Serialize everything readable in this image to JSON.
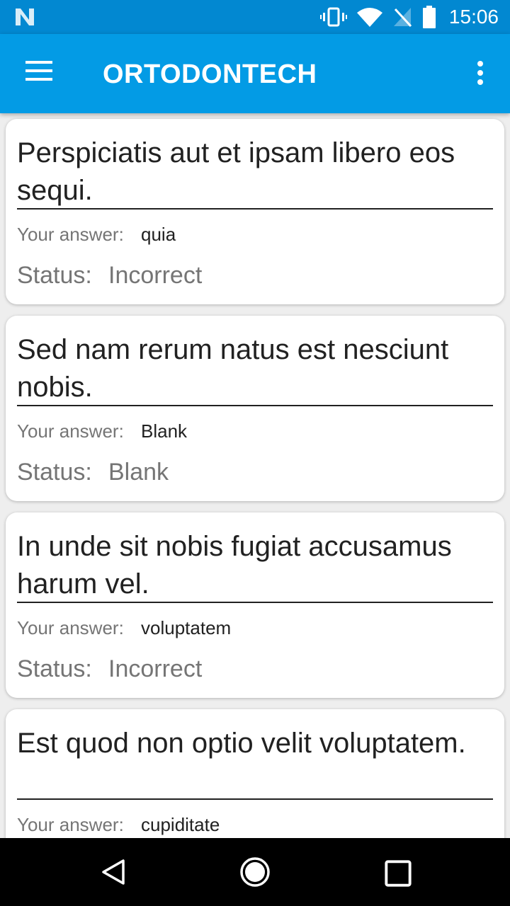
{
  "status_bar": {
    "time": "15:06",
    "icons": [
      "n-logo-icon",
      "vibrate-icon",
      "wifi-icon",
      "no-sim-icon",
      "battery-icon"
    ]
  },
  "app_bar": {
    "title": "ORTODONTECH",
    "icons": [
      "menu-icon",
      "more-vert-icon"
    ]
  },
  "colors": {
    "status_bar": "#0288d1",
    "app_bar": "#039be5",
    "background": "#eeeeee",
    "card": "#ffffff"
  },
  "labels": {
    "your_answer": "Your answer:",
    "status": "Status:"
  },
  "questions": [
    {
      "text": "Perspiciatis aut et ipsam libero eos sequi.",
      "answer": "quia",
      "status": "Incorrect"
    },
    {
      "text": "Sed nam rerum natus est nesciunt nobis.",
      "answer": "Blank",
      "status": "Blank"
    },
    {
      "text": "In unde sit nobis fugiat accusamus harum vel.",
      "answer": "voluptatem",
      "status": "Incorrect"
    },
    {
      "text": "Est quod non optio velit voluptatem.",
      "answer": "cupiditate",
      "status": ""
    }
  ],
  "nav_bar": {
    "icons": [
      "back-icon",
      "home-icon",
      "recents-icon"
    ]
  }
}
